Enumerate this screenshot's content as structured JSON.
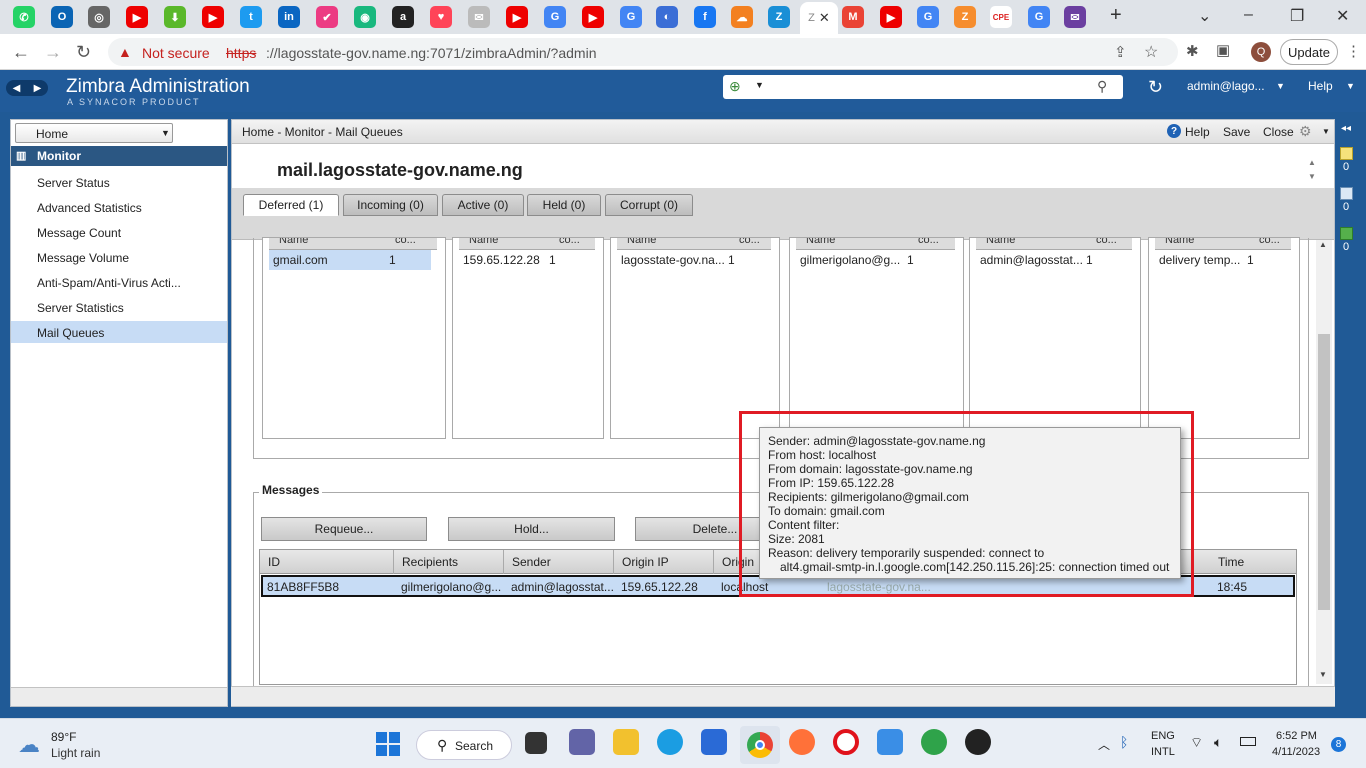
{
  "browser": {
    "tab_glyphs": [
      "✆",
      "O",
      "◎",
      "▶",
      "⬇",
      "▶",
      "t",
      "in",
      "✔",
      "◉",
      "a",
      "♥",
      "✉",
      "▶",
      "G",
      "▶",
      "G",
      "◐",
      "f",
      "☁",
      "Z"
    ],
    "active_tab_close": "✕",
    "after_tab_glyphs": [
      "M",
      "▶",
      "G",
      "Z",
      "CPE",
      "G",
      "✉"
    ],
    "new_tab": "+",
    "security_label": "Not secure",
    "url_scheme": "https",
    "url_rest": "://lagosstate-gov.name.ng:7071/zimbraAdmin/?admin",
    "profile_initial": "Q",
    "update_label": "Update"
  },
  "header": {
    "title": "Zimbra Administration",
    "subtitle": "A SYNACOR PRODUCT",
    "user": "admin@lago...",
    "help": "Help"
  },
  "sidebar": {
    "home_label": "Home",
    "section": "Monitor",
    "items": [
      "Server Status",
      "Advanced Statistics",
      "Message Count",
      "Message Volume",
      "Anti-Spam/Anti-Virus Acti...",
      "Server Statistics",
      "Mail Queues"
    ]
  },
  "main": {
    "breadcrumb": "Home - Monitor - Mail Queues",
    "help": "Help",
    "save": "Save",
    "close": "Close",
    "server_title": "mail.lagosstate-gov.name.ng",
    "tabs": [
      "Deferred (1)",
      "Incoming (0)",
      "Active (0)",
      "Held (0)",
      "Corrupt (0)"
    ],
    "summary_cols": [
      {
        "h1": "Name",
        "h2": "co...",
        "name": "gmail.com",
        "count": "1"
      },
      {
        "h1": "Name",
        "h2": "co...",
        "name": "159.65.122.28",
        "count": "1"
      },
      {
        "h1": "Name",
        "h2": "co...",
        "name": "lagosstate-gov.na...",
        "count": "1"
      },
      {
        "h1": "Name",
        "h2": "co...",
        "name": "gilmerigolano@g...",
        "count": "1"
      },
      {
        "h1": "Name",
        "h2": "co...",
        "name": "admin@lagosstat...",
        "count": "1"
      },
      {
        "h1": "Name",
        "h2": "co...",
        "name": "delivery temp...",
        "count": "1"
      }
    ],
    "messages_label": "Messages",
    "buttons": [
      "Requeue...",
      "Hold...",
      "Delete..."
    ],
    "table_headers": [
      "ID",
      "Recipients",
      "Sender",
      "Origin IP",
      "Origin",
      "Time"
    ],
    "row": {
      "id": "81AB8FF5B8",
      "recipients": "gilmerigolano@g...",
      "sender": "admin@lagosstat...",
      "origin_ip": "159.65.122.28",
      "origin": "localhost",
      "faded": "lagosstate-gov.na...",
      "time": "18:45"
    }
  },
  "tooltip": {
    "lines": [
      "Sender: admin@lagosstate-gov.name.ng",
      "From host: localhost",
      "From domain: lagosstate-gov.name.ng",
      "From IP: 159.65.122.28",
      "Recipients: gilmerigolano@gmail.com",
      "To domain: gmail.com",
      "Content filter:",
      "Size: 2081",
      "Reason: delivery temporarily suspended: connect to"
    ],
    "reason_cont": "alt4.gmail-smtp-in.l.google.com[142.250.115.26]:25: connection timed out"
  },
  "right_badges": [
    "0",
    "0",
    "0"
  ],
  "taskbar": {
    "temp": "89°F",
    "weather": "Light rain",
    "search": "Search",
    "lang1": "ENG",
    "lang2": "INTL",
    "time": "6:52 PM",
    "date": "4/11/2023",
    "notif": "8"
  },
  "colors": {
    "zimbra_blue": "#215b9a",
    "selection": "#c7dcf5",
    "highlight_box": "#e01b24"
  }
}
